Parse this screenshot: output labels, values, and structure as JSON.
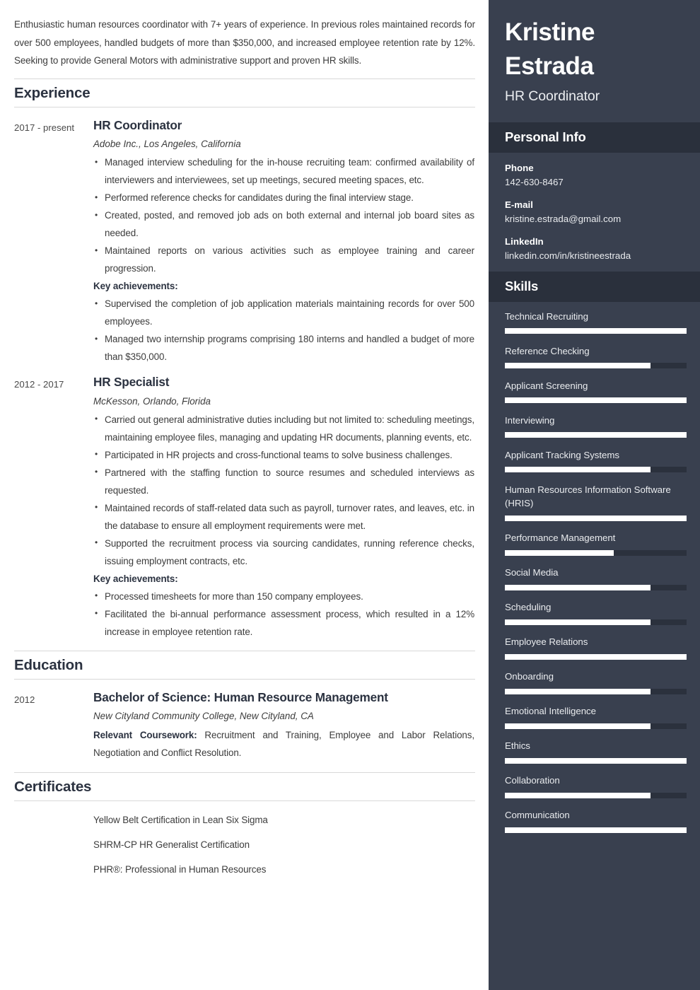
{
  "summary": "Enthusiastic human resources coordinator with 7+ years of experience. In previous roles maintained records for over 500 employees, handled budgets of more than $350,000, and increased employee retention rate by 12%. Seeking to provide General Motors with administrative support and proven HR skills.",
  "sections": {
    "experience_title": "Experience",
    "education_title": "Education",
    "certificates_title": "Certificates"
  },
  "experience": [
    {
      "date": "2017 - present",
      "title": "HR Coordinator",
      "subtitle": "Adobe Inc., Los Angeles, California",
      "bullets": [
        "Managed interview scheduling for the in-house recruiting team: confirmed availability of interviewers and interviewees, set up meetings, secured meeting spaces, etc.",
        "Performed reference checks for candidates during the final interview stage.",
        "Created, posted, and removed job ads on both external and internal job board sites as needed.",
        "Maintained reports on various activities such as employee training and career progression."
      ],
      "key_achievements_label": "Key achievements:",
      "achievements": [
        "Supervised the completion of job application materials maintaining records for over 500 employees.",
        "Managed two internship programs comprising 180 interns and handled a budget of more than $350,000."
      ]
    },
    {
      "date": "2012 - 2017",
      "title": "HR Specialist",
      "subtitle": "McKesson, Orlando, Florida",
      "bullets": [
        "Carried out general administrative duties including but not limited to: scheduling meetings, maintaining employee files, managing and updating HR documents, planning events, etc.",
        "Participated in HR projects and cross-functional teams to solve business challenges.",
        "Partnered with the staffing function to source resumes and scheduled interviews as requested.",
        "Maintained records of staff-related data such as payroll, turnover rates, and leaves, etc. in the database to ensure all employment requirements were met.",
        "Supported the recruitment process via sourcing candidates, running reference checks, issuing employment contracts, etc."
      ],
      "key_achievements_label": "Key achievements:",
      "achievements": [
        "Processed timesheets for more than 150 company employees.",
        "Facilitated the bi-annual performance assessment process, which resulted in a 12% increase in employee retention rate."
      ]
    }
  ],
  "education": [
    {
      "date": "2012",
      "title": "Bachelor of Science: Human Resource Management",
      "subtitle": "New Cityland Community College, New Cityland, CA",
      "coursework_label": "Relevant Coursework:",
      "coursework_text": " Recruitment and Training, Employee and Labor Relations, Negotiation and Conflict Resolution."
    }
  ],
  "certificates": [
    "Yellow Belt Certification in Lean Six Sigma",
    "SHRM-CP HR Generalist Certification",
    "PHR®: Professional in Human Resources"
  ],
  "sidebar": {
    "name": "Kristine Estrada",
    "role": "HR Coordinator",
    "personal_info_title": "Personal Info",
    "contacts": [
      {
        "label": "Phone",
        "value": "142-630-8467"
      },
      {
        "label": "E-mail",
        "value": "kristine.estrada@gmail.com"
      },
      {
        "label": "LinkedIn",
        "value": "linkedin.com/in/kristineestrada"
      }
    ],
    "skills_title": "Skills",
    "skills": [
      {
        "name": "Technical Recruiting",
        "level": 100
      },
      {
        "name": "Reference Checking",
        "level": 80
      },
      {
        "name": "Applicant Screening",
        "level": 100
      },
      {
        "name": "Interviewing",
        "level": 100
      },
      {
        "name": "Applicant Tracking Systems",
        "level": 80
      },
      {
        "name": "Human Resources Information Software (HRIS)",
        "level": 100
      },
      {
        "name": "Performance Management",
        "level": 60
      },
      {
        "name": "Social Media",
        "level": 80
      },
      {
        "name": "Scheduling",
        "level": 80
      },
      {
        "name": "Employee Relations",
        "level": 100
      },
      {
        "name": "Onboarding",
        "level": 80
      },
      {
        "name": "Emotional Intelligence",
        "level": 80
      },
      {
        "name": "Ethics",
        "level": 100
      },
      {
        "name": "Collaboration",
        "level": 80
      },
      {
        "name": "Communication",
        "level": 100
      }
    ]
  },
  "colors": {
    "sidebar_bg": "#39404f",
    "sidebar_band": "#2a303c",
    "track": "#2b313d",
    "fill": "#ffffff",
    "heading": "#2b3240",
    "body_text": "#3c3c3c",
    "rule": "#d8d8d8"
  }
}
